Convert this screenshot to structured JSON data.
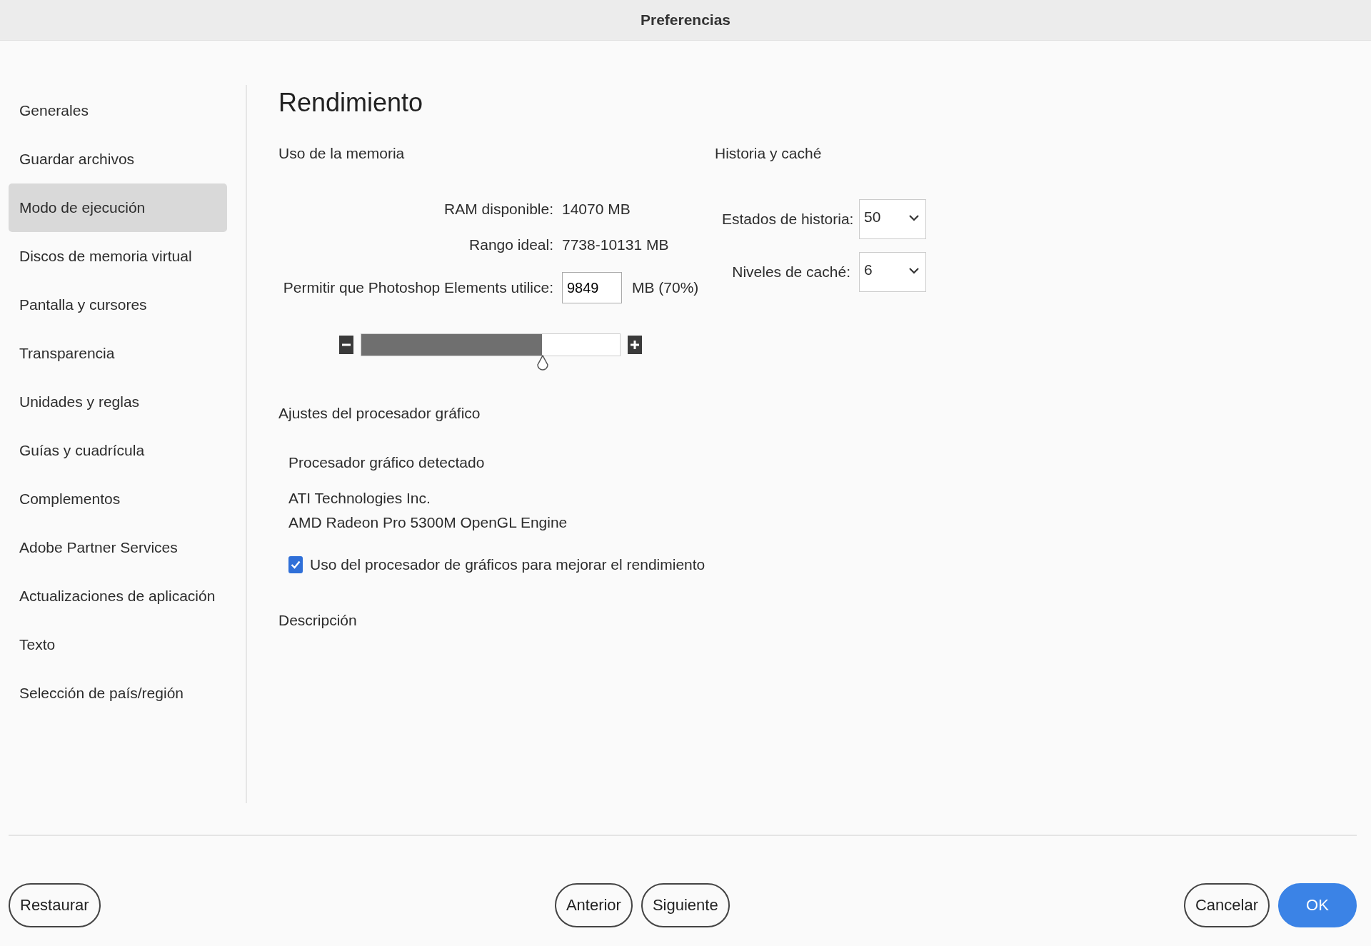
{
  "window": {
    "title": "Preferencias"
  },
  "sidebar": {
    "items": [
      {
        "label": "Generales",
        "selected": false
      },
      {
        "label": "Guardar archivos",
        "selected": false
      },
      {
        "label": "Modo de ejecución",
        "selected": true
      },
      {
        "label": "Discos de memoria virtual",
        "selected": false
      },
      {
        "label": "Pantalla y cursores",
        "selected": false
      },
      {
        "label": "Transparencia",
        "selected": false
      },
      {
        "label": "Unidades y reglas",
        "selected": false
      },
      {
        "label": "Guías y cuadrícula",
        "selected": false
      },
      {
        "label": "Complementos",
        "selected": false
      },
      {
        "label": "Adobe Partner Services",
        "selected": false
      },
      {
        "label": "Actualizaciones de aplicación",
        "selected": false
      },
      {
        "label": "Texto",
        "selected": false
      },
      {
        "label": "Selección de país/región",
        "selected": false
      }
    ]
  },
  "page": {
    "title": "Rendimiento"
  },
  "memory": {
    "heading": "Uso de la memoria",
    "rows": [
      {
        "label": "RAM disponible:",
        "value": "14070 MB"
      },
      {
        "label": "Rango ideal:",
        "value": "7738-10131 MB"
      }
    ],
    "allow": {
      "label": "Permitir que Photoshop Elements utilice:",
      "value": "9849",
      "unit": "MB (70%)"
    },
    "slider": {
      "level": 0.7
    }
  },
  "history_cache": {
    "heading": "Historia y caché",
    "fields": [
      {
        "label": "Estados de historia:",
        "value": "50"
      },
      {
        "label": "Niveles de caché:",
        "value": "6"
      }
    ]
  },
  "gpu": {
    "heading": "Ajustes del procesador gráfico",
    "detected_label": "Procesador gráfico detectado",
    "vendor": "ATI Technologies Inc.",
    "renderer": "AMD Radeon Pro 5300M OpenGL Engine",
    "checkbox": {
      "label": "Uso del procesador de gráficos para mejorar el rendimiento",
      "checked": true
    }
  },
  "description": {
    "heading": "Descripción"
  },
  "footer": {
    "left": [
      {
        "label": "Restaurar",
        "kind": "secondary"
      }
    ],
    "center": [
      {
        "label": "Anterior",
        "kind": "secondary"
      },
      {
        "label": "Siguiente",
        "kind": "secondary"
      }
    ],
    "right": [
      {
        "label": "Cancelar",
        "kind": "secondary"
      },
      {
        "label": "OK",
        "kind": "primary"
      }
    ]
  }
}
